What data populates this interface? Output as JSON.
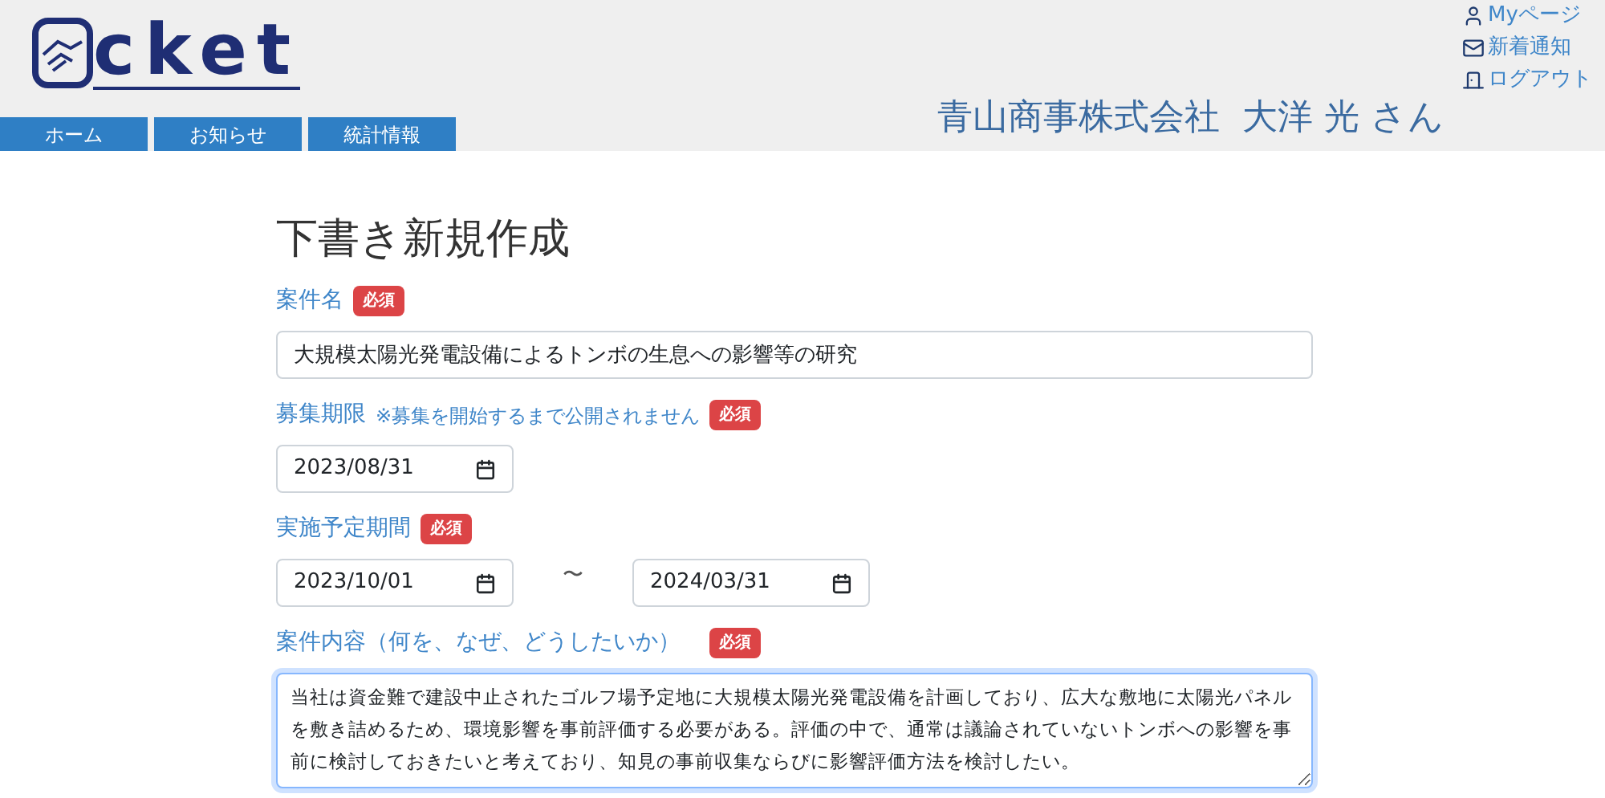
{
  "header": {
    "logo_text": "cket",
    "nav": [
      {
        "label": "ホーム"
      },
      {
        "label": "お知らせ"
      },
      {
        "label": "統計情報"
      }
    ],
    "user_links": [
      {
        "kind": "user",
        "label": "Myページ"
      },
      {
        "kind": "mail",
        "label": "新着通知"
      },
      {
        "kind": "logout",
        "label": "ログアウト"
      }
    ],
    "user_name": "青山商事株式会社  大洋 光 さん"
  },
  "form": {
    "title": "下書き新規作成",
    "fields": [
      {
        "kind": "text",
        "label": "案件名",
        "badge": "必須",
        "value": "大規模太陽光発電設備によるトンボの生息への影響等の研究"
      },
      {
        "kind": "date",
        "label": "募集期限",
        "note": "※募集を開始するまで公開されません",
        "badge": "必須",
        "value": "2023/08/31"
      },
      {
        "kind": "range",
        "label": "実施予定期間",
        "badge": "必須",
        "from": "2023/10/01",
        "separator": "〜",
        "to": "2024/03/31"
      },
      {
        "kind": "textarea",
        "label": "案件内容（何を、なぜ、どうしたいか）",
        "badge": "必須",
        "value": "当社は資金難で建設中止されたゴルフ場予定地に大規模太陽光発電設備を計画しており、広大な敷地に太陽光パネルを敷き詰めるため、環境影響を事前評価する必要がある。評価の中で、通常は議論されていないトンボへの影響を事前に検討しておきたいと考えており、知見の事前収集ならびに影響評価方法を検討したい。"
      }
    ]
  }
}
